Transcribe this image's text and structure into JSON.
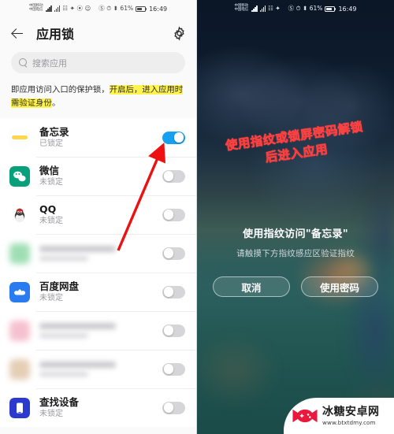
{
  "left": {
    "status": {
      "carrier_line1": "中国移动",
      "carrier_line2": "中国电信",
      "battery_percent": "61%",
      "clock": "16:49"
    },
    "header": {
      "title": "应用锁",
      "back_icon": "back-arrow-icon",
      "settings_icon": "gear-icon"
    },
    "search": {
      "placeholder": "搜索应用",
      "icon": "search-icon"
    },
    "description": {
      "plain": "即应用访问入口的保护锁，",
      "highlight": "开启后，进入应用时需验证身份",
      "tail": "。"
    },
    "apps": [
      {
        "name": "备忘录",
        "state": "已锁定",
        "icon": "notepad-icon",
        "toggle": "on",
        "blurred": false
      },
      {
        "name": "微信",
        "state": "未锁定",
        "icon": "wechat-icon",
        "toggle": "off",
        "blurred": false
      },
      {
        "name": "QQ",
        "state": "未锁定",
        "icon": "qq-icon",
        "toggle": "off",
        "blurred": false
      },
      {
        "name": "",
        "state": "",
        "icon": "hidden-app-icon",
        "toggle": "off",
        "blurred": true
      },
      {
        "name": "百度网盘",
        "state": "未锁定",
        "icon": "baidu-netdisk-icon",
        "toggle": "off",
        "blurred": false
      },
      {
        "name": "",
        "state": "",
        "icon": "hidden-app-icon",
        "toggle": "off",
        "blurred": true
      },
      {
        "name": "",
        "state": "",
        "icon": "hidden-app-icon",
        "toggle": "off",
        "blurred": true
      },
      {
        "name": "查找设备",
        "state": "未锁定",
        "icon": "find-device-icon",
        "toggle": "off",
        "blurred": false
      }
    ],
    "annotation_arrow": "red-arrow-pointing-to-toggle",
    "colors": {
      "toggle_on": "#18a0f0",
      "highlight": "#fff34d",
      "arrow": "#ee1111"
    }
  },
  "right": {
    "status": {
      "carrier_line1": "中国移动",
      "carrier_line2": "中国电信",
      "battery_percent": "61%",
      "clock": "16:49"
    },
    "annotation": {
      "line1": "使用指纹或锁屏密码解锁",
      "line2": "后进入应用",
      "color": "#ff1f1f"
    },
    "dialog": {
      "title": "使用指纹访问\"备忘录\"",
      "subtitle": "请触摸下方指纹感应区验证指纹",
      "cancel_label": "取消",
      "password_label": "使用密码"
    },
    "fingerprint_icon": "fingerprint-icon"
  },
  "watermark": {
    "name": "冰糖安卓网",
    "url": "www.btxtdmy.com",
    "logo": "candy-gamepad-logo"
  }
}
